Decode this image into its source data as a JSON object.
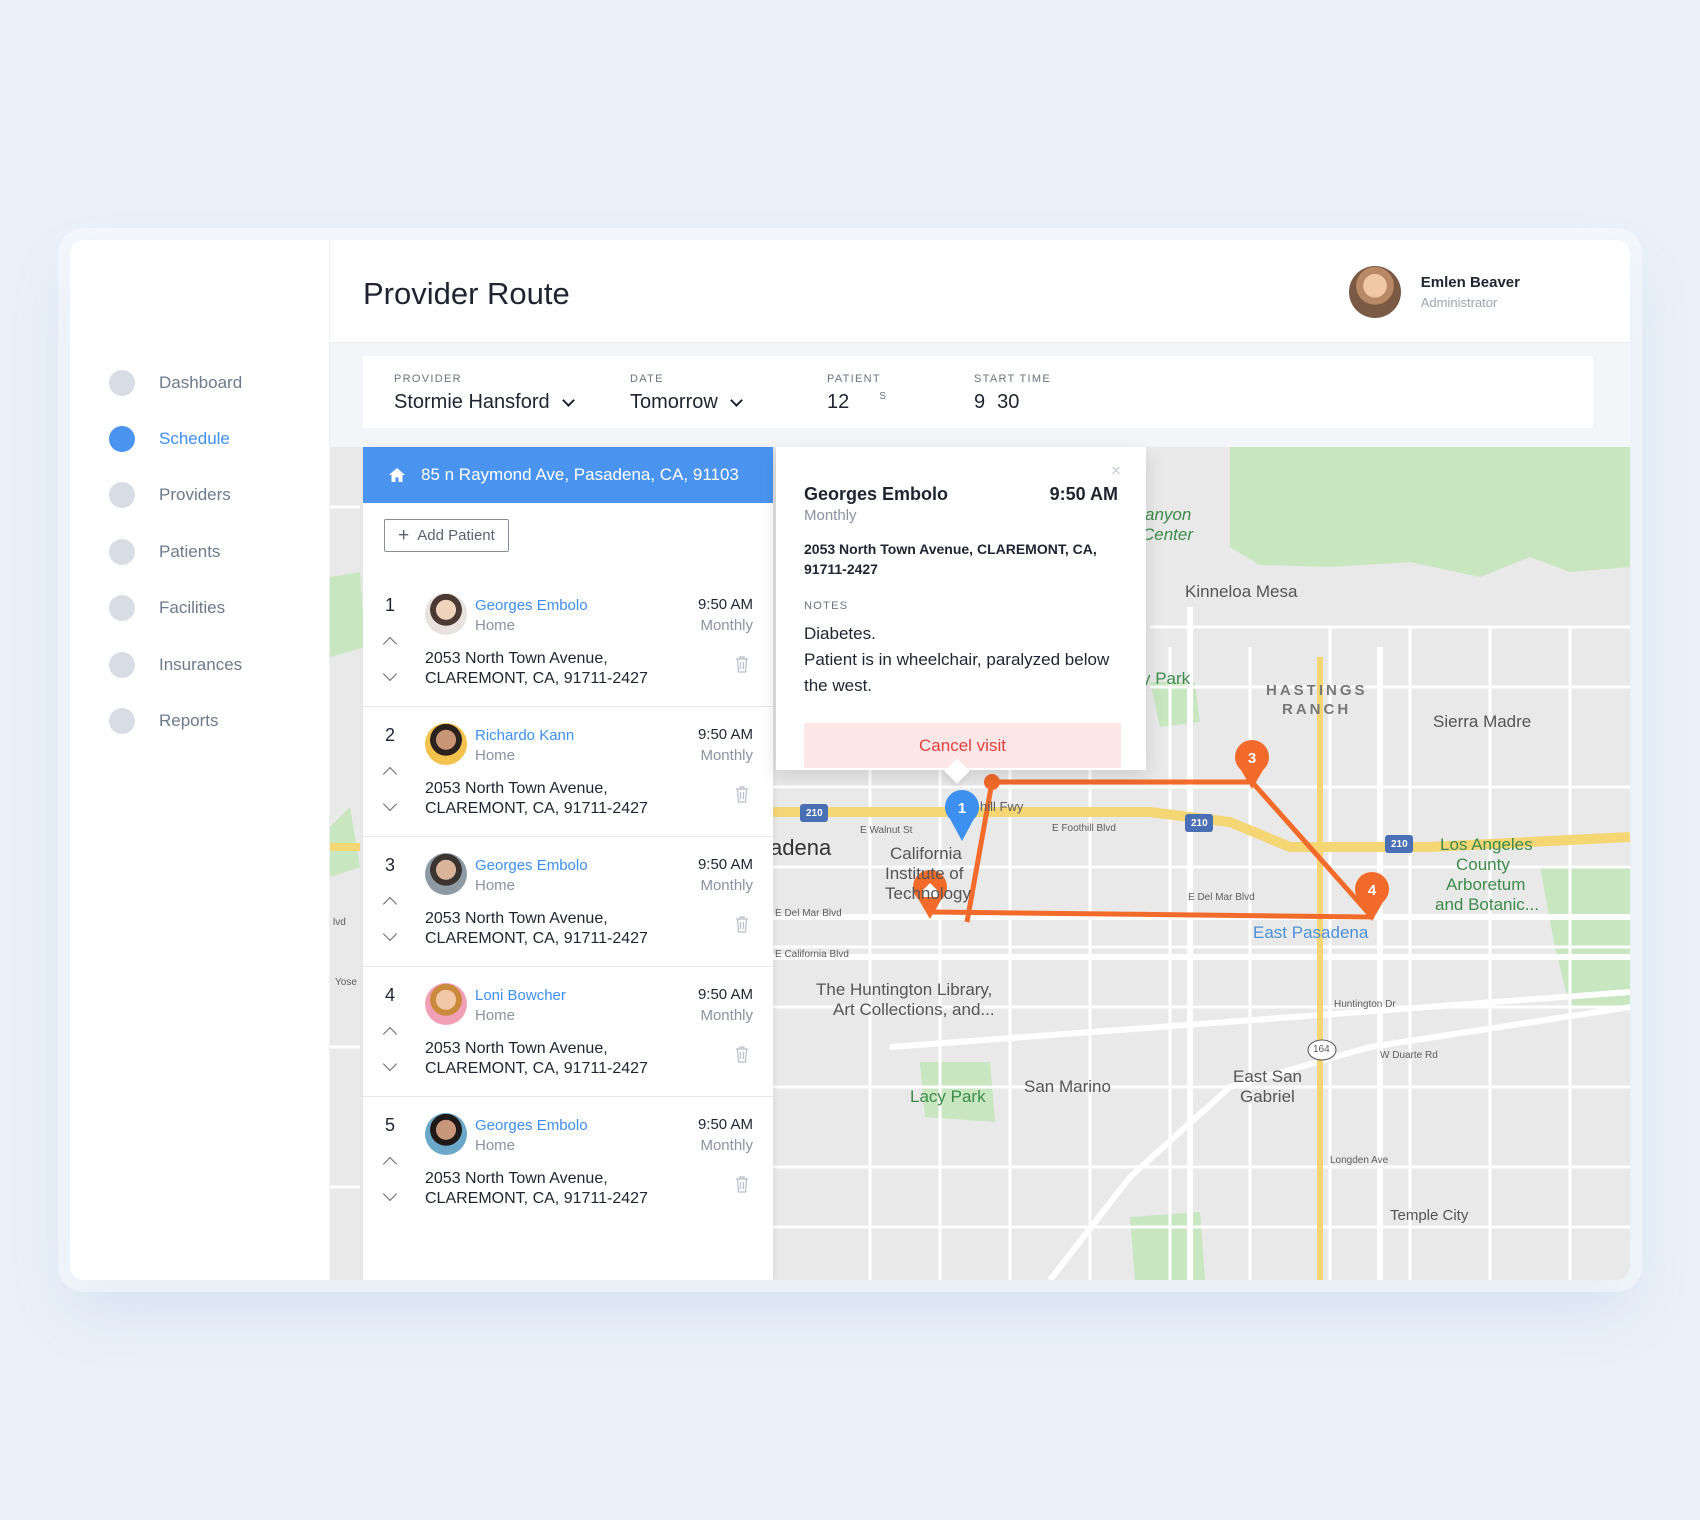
{
  "sidebar": {
    "items": [
      {
        "label": "Dashboard"
      },
      {
        "label": "Schedule"
      },
      {
        "label": "Providers"
      },
      {
        "label": "Patients"
      },
      {
        "label": "Facilities"
      },
      {
        "label": "Insurances"
      },
      {
        "label": "Reports"
      }
    ],
    "active": "Schedule"
  },
  "header": {
    "title": "Provider Route",
    "user": {
      "name": "Emlen Beaver",
      "role": "Administrator"
    }
  },
  "filters": {
    "provider": {
      "label": "PROVIDER",
      "value": "Stormie Hansford"
    },
    "date": {
      "label": "DATE",
      "value": "Tomorrow"
    },
    "patients": {
      "label": "PATIENT",
      "value": "12",
      "suffix": "S"
    },
    "start_time": {
      "label": "START TIME",
      "hour": "9",
      "minute": "30"
    }
  },
  "route": {
    "home_address": "85 n Raymond Ave, Pasadena, CA, 91103",
    "add_patient_label": "Add Patient",
    "stops": [
      {
        "num": "1",
        "name": "Georges Embolo",
        "type": "Home",
        "time": "9:50 AM",
        "frequency": "Monthly",
        "address_line1": "2053 North Town Avenue,",
        "address_line2": "CLAREMONT, CA, 91711-2427"
      },
      {
        "num": "2",
        "name": "Richardo Kann",
        "type": "Home",
        "time": "9:50 AM",
        "frequency": "Monthly",
        "address_line1": "2053 North Town Avenue,",
        "address_line2": "CLAREMONT, CA, 91711-2427"
      },
      {
        "num": "3",
        "name": "Georges Embolo",
        "type": "Home",
        "time": "9:50 AM",
        "frequency": "Monthly",
        "address_line1": "2053 North Town Avenue,",
        "address_line2": "CLAREMONT, CA, 91711-2427"
      },
      {
        "num": "4",
        "name": "Loni Bowcher",
        "type": "Home",
        "time": "9:50 AM",
        "frequency": "Monthly",
        "address_line1": "2053 North Town Avenue,",
        "address_line2": "CLAREMONT, CA, 91711-2427"
      },
      {
        "num": "5",
        "name": "Georges Embolo",
        "type": "Home",
        "time": "9:50 AM",
        "frequency": "Monthly",
        "address_line1": "2053 North Town Avenue,",
        "address_line2": "CLAREMONT, CA, 91711-2427"
      }
    ]
  },
  "popup": {
    "name": "Georges Embolo",
    "time": "9:50 AM",
    "frequency": "Monthly",
    "address": "2053 North Town Avenue, CLAREMONT, CA, 91711-2427",
    "notes_label": "NOTES",
    "notes_line1": "Diabetes.",
    "notes_line2": "Patient is in wheelchair, paralyzed below the west.",
    "cancel_label": "Cancel visit",
    "close_glyph": "×"
  },
  "map": {
    "labels": {
      "canyon_center_1": "anyon",
      "canyon_center_2": "Center",
      "kinneloa": "Kinneloa Mesa",
      "hastings_1": "HASTINGS",
      "hastings_2": "RANCH",
      "park": "y Park",
      "sierra_madre": "Sierra Madre",
      "hill_fwy": "hill Fwy",
      "walnut": "E Walnut St",
      "foothill": "E Foothill Blvd",
      "pasadena": "adena",
      "caltech_1": "California",
      "caltech_2": "Institute of",
      "caltech_3": "Technology",
      "del_mar_left": "E Del Mar Blvd",
      "del_mar_right": "E Del Mar Blvd",
      "california_blvd": "E California Blvd",
      "east_pasadena": "East Pasadena",
      "la_arboretum_1": "Los Angeles",
      "la_arboretum_2": "County",
      "la_arboretum_3": "Arboretum",
      "la_arboretum_4": "and Botanic...",
      "huntington_1": "The Huntington Library,",
      "huntington_2": "Art Collections, and...",
      "lacy_park": "Lacy Park",
      "san_marino": "San Marino",
      "east_san_gabriel_1": "East San",
      "east_san_gabriel_2": "Gabriel",
      "huntington_dr": "Huntington Dr",
      "duarte": "W Duarte Rd",
      "longden": "Longden Ave",
      "temple": "Temple City",
      "shield_210_a": "210",
      "shield_210_b": "210",
      "shield_210_c": "210",
      "shield_164": "164",
      "yose": "Yose",
      "lvd": "lvd"
    },
    "markers": [
      {
        "label": "1",
        "color": "#3d8ff0"
      },
      {
        "label": "3",
        "color": "#f26b2b"
      },
      {
        "label": "4",
        "color": "#f26b2b"
      },
      {
        "label": "home",
        "color": "#f26b2b"
      }
    ],
    "route_color": "#f26b2b"
  }
}
